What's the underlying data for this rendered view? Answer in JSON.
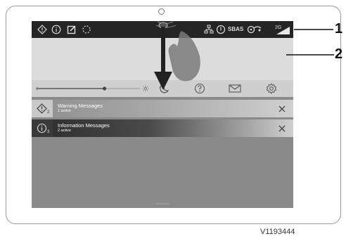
{
  "status_bar": {
    "icons": [
      "warning-icon",
      "info-icon",
      "edit-icon",
      "loading-icon",
      "network-icon",
      "power-icon",
      "gps-icon",
      "signal-icon"
    ],
    "sbas_label": "SBAS",
    "network_label": "2G"
  },
  "controls": {
    "slider_value": 0.65,
    "icons": [
      "brightness-icon",
      "night-mode-icon",
      "help-icon",
      "message-icon",
      "settings-icon"
    ]
  },
  "notifications": [
    {
      "title": "Warning Messages",
      "subtitle": "1 active",
      "count": "2"
    },
    {
      "title": "Information Messages",
      "subtitle": "2 active",
      "count": "3"
    }
  ],
  "callouts": [
    "1",
    "2"
  ],
  "figure_code": "V1193444",
  "gesture": "swipe-down"
}
